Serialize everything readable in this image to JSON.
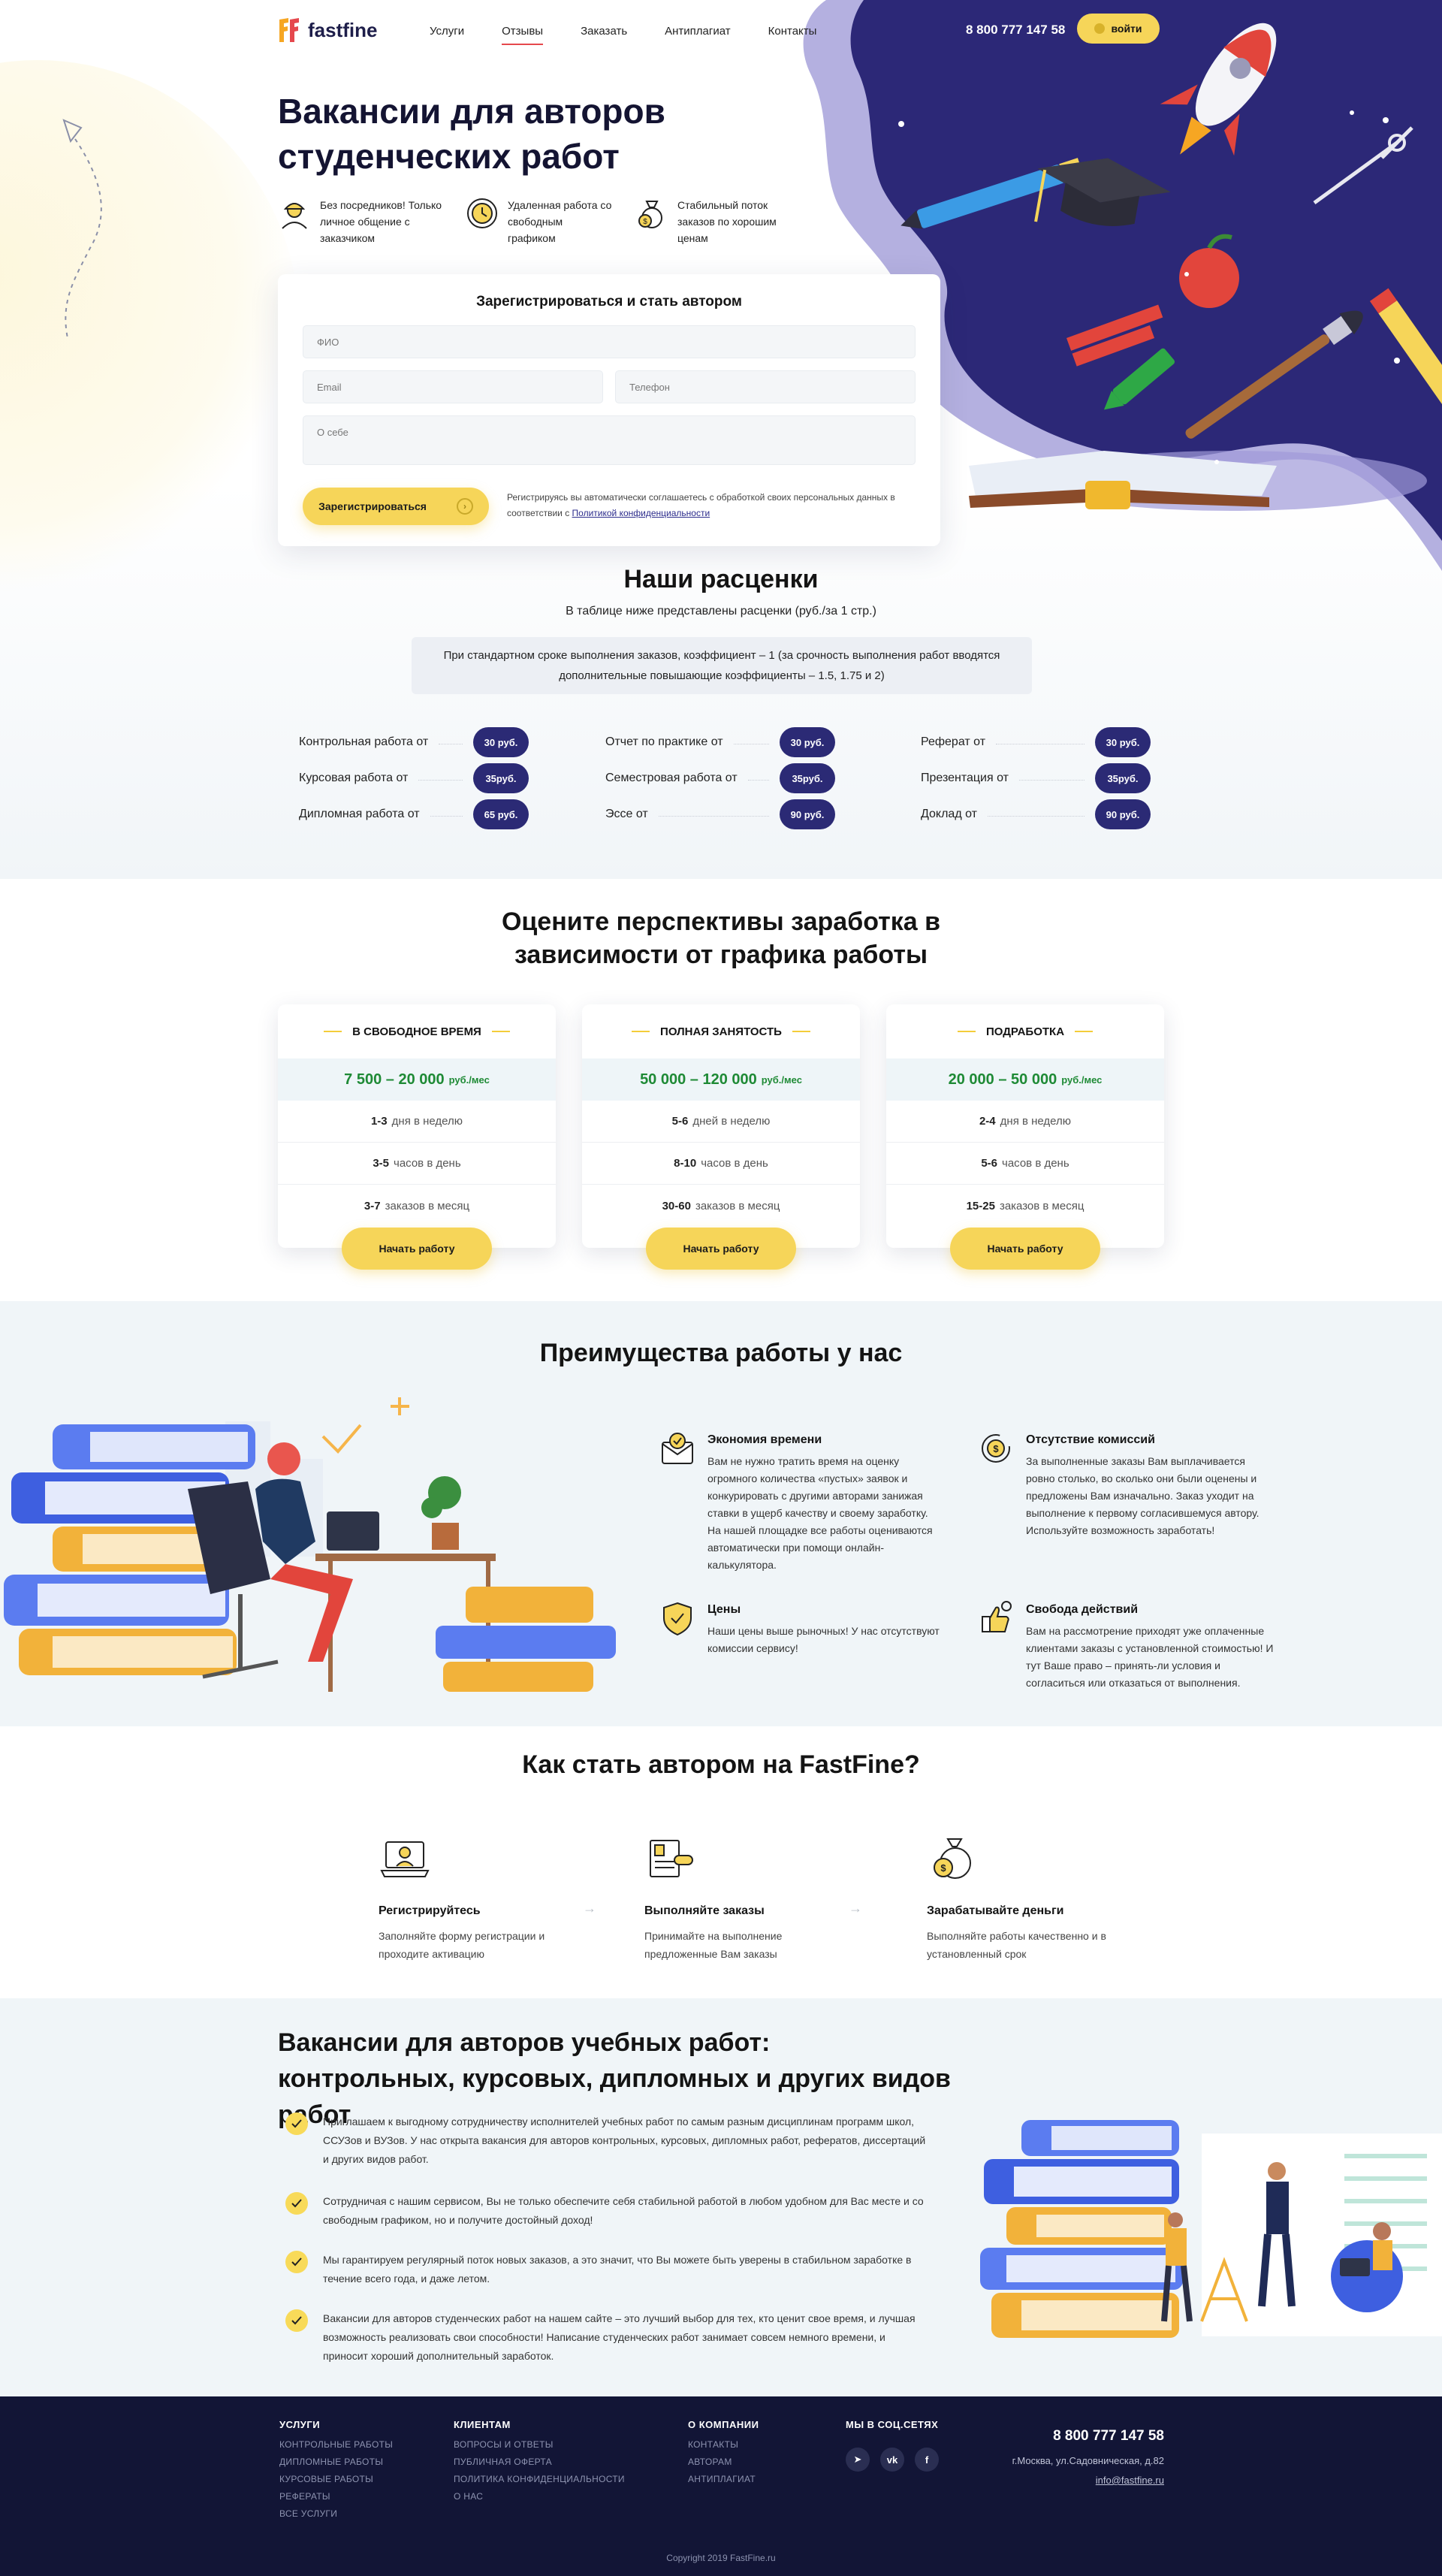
{
  "header": {
    "logo_text": "fastfine",
    "nav": [
      "Услуги",
      "Отзывы",
      "Заказать",
      "Антиплагиат",
      "Контакты"
    ],
    "phone": "8 800 777 147 58",
    "login_label": "войти"
  },
  "hero": {
    "title": "Вакансии для авторов студенческих работ",
    "features": [
      {
        "icon": "person-helmet-icon",
        "text": "Без посредников! Только личное общение с заказчиком"
      },
      {
        "icon": "clock-icon",
        "text": "Удаленная работа со свободным графиком"
      },
      {
        "icon": "money-bag-icon",
        "text": "Стабильный поток заказов по хорошим ценам"
      }
    ]
  },
  "form": {
    "title": "Зарегистрироваться и стать автором",
    "name_placeholder": "ФИО",
    "email_placeholder": "Email",
    "phone_placeholder": "Телефон",
    "about_placeholder": "О себе",
    "submit_label": "Зарегистрироваться",
    "note_text": "Регистрируясь вы автоматически соглашаетесь с обработкой своих персональных данных в соответствии с",
    "note_link": "Политикой конфиденциальности"
  },
  "prices": {
    "title": "Наши расценки",
    "subtitle": "В таблице ниже представлены расценки (руб./за 1 стр.)",
    "note_line1": "При стандартном сроке выполнения заказов, коэффициент – 1 (за срочность выполнения работ вводятся",
    "note_line2": "дополнительные повышающие коэффициенты – 1.5, 1.75 и 2)",
    "items": [
      {
        "label": "Контрольная работа от",
        "price": "30 руб."
      },
      {
        "label": "Отчет по практике от",
        "price": "30 руб."
      },
      {
        "label": "Реферат от",
        "price": "30 руб."
      },
      {
        "label": "Курсовая работа от",
        "price": "35руб."
      },
      {
        "label": "Семестровая работа от",
        "price": "35руб."
      },
      {
        "label": "Презентация от",
        "price": "35руб."
      },
      {
        "label": "Дипломная работа от",
        "price": "65 руб."
      },
      {
        "label": "Эссе от",
        "price": "90 руб."
      },
      {
        "label": "Доклад от",
        "price": "90 руб."
      }
    ]
  },
  "plans": {
    "title_line1": "Оцените перспективы заработка в",
    "title_line2": "зависимости от графика работы",
    "cta_label": "Начать работу",
    "items": [
      {
        "name": "В СВОБОДНОЕ ВРЕМЯ",
        "income": "7 500 – 20 000",
        "unit": "руб./мес",
        "days_num": "1-3",
        "days_text": "дня в неделю",
        "hours_num": "3-5",
        "hours_text": "часов в день",
        "orders_num": "3-7",
        "orders_text": "заказов в месяц"
      },
      {
        "name": "ПОЛНАЯ ЗАНЯТОСТЬ",
        "income": "50 000 – 120 000",
        "unit": "руб./мес",
        "days_num": "5-6",
        "days_text": "дней в неделю",
        "hours_num": "8-10",
        "hours_text": "часов в день",
        "orders_num": "30-60",
        "orders_text": "заказов в месяц"
      },
      {
        "name": "ПОДРАБОТКА",
        "income": "20 000 – 50 000",
        "unit": "руб./мес",
        "days_num": "2-4",
        "days_text": "дня в неделю",
        "hours_num": "5-6",
        "hours_text": "часов в день",
        "orders_num": "15-25",
        "orders_text": "заказов в месяц"
      }
    ]
  },
  "advantages": {
    "title": "Преимущества работы у нас",
    "items": [
      {
        "icon": "envelope-check-icon",
        "title": "Экономия времени",
        "text": "Вам не нужно тратить время на оценку огромного количества «пустых» заявок и конкурировать с другими авторами занижая ставки в ущерб качеству и своему заработку. На нашей площадке все работы оцениваются автоматически при помощи онлайн-калькулятора."
      },
      {
        "icon": "dollar-cycle-icon",
        "title": "Отсутствие комиссий",
        "text": "За выполненные заказы Вам выплачивается ровно столько, во сколько они были оценены и предложены Вам изначально. Заказ уходит на выполнение к первому согласившемуся автору. Используйте возможность заработать!"
      },
      {
        "icon": "shield-check-icon",
        "title": "Цены",
        "text": "Наши цены выше рыночных! У нас отсутствуют комиссии сервису!"
      },
      {
        "icon": "hand-thumb-icon",
        "title": "Свобода действий",
        "text": "Вам на рассмотрение приходят уже оплаченные клиентами заказы с установленной стоимостью! И тут Ваше право – принять-ли условия и согласиться или отказаться от выполнения."
      }
    ]
  },
  "steps": {
    "title": "Как стать автором на FastFine?",
    "items": [
      {
        "icon": "laptop-user-icon",
        "title": "Регистрируйтесь",
        "text": "Заполняйте форму регистрации и проходите активацию"
      },
      {
        "icon": "documents-icon",
        "title": "Выполняйте заказы",
        "text": "Принимайте на выполнение предложенные Вам заказы"
      },
      {
        "icon": "coin-bag-icon",
        "title": "Зарабатывайте деньги",
        "text": "Выполняйте работы качественно и в установленный срок"
      }
    ]
  },
  "vacancies": {
    "title": "Вакансии для авторов учебных работ: контрольных, курсовых, дипломных и других видов работ",
    "items": [
      "Приглашаем к выгодному сотрудничеству исполнителей учебных работ по самым разным дисциплинам программ школ, ССУЗов и ВУЗов. У нас открыта вакансия для авторов контрольных, курсовых, дипломных работ, рефератов, диссертаций и других видов работ.",
      "Сотрудничая с нашим сервисом, Вы не только обеспечите себя стабильной работой в любом удобном для Вас месте и со свободным графиком, но и получите достойный доход!",
      "Мы гарантируем регулярный поток новых заказов, а это значит, что Вы можете быть уверены в стабильном заработке в течение всего года, и даже летом.",
      "Вакансии для авторов студенческих работ на нашем сайте – это лучший выбор для тех, кто ценит свое время, и лучшая возможность реализовать свои способности! Написание студенческих работ занимает совсем немного времени, и приносит хороший дополнительный заработок."
    ]
  },
  "footer": {
    "columns": [
      {
        "title": "УСЛУГИ",
        "links": [
          "КОНТРОЛЬНЫЕ РАБОТЫ",
          "ДИПЛОМНЫЕ РАБОТЫ",
          "КУРСОВЫЕ РАБОТЫ",
          "РЕФЕРАТЫ",
          "ВСЕ УСЛУГИ"
        ]
      },
      {
        "title": "КЛИЕНТАМ",
        "links": [
          "ВОПРОСЫ И ОТВЕТЫ",
          "ПУБЛИЧНАЯ ОФЕРТА",
          "ПОЛИТИКА КОНФИДЕНЦИАЛЬНОСТИ",
          "О НАС"
        ]
      },
      {
        "title": "О КОМПАНИИ",
        "links": [
          "КОНТАКТЫ",
          "АВТОРАМ",
          "АНТИПЛАГИАТ"
        ]
      }
    ],
    "social_title": "МЫ В СОЦ.СЕТЯХ",
    "social": [
      "telegram-icon",
      "vk-icon",
      "facebook-icon"
    ],
    "phone": "8 800 777 147 58",
    "address": "г.Москва, ул.Садовническая, д.82",
    "email": "info@fastfine.ru",
    "copyright": "Copyright 2019 FastFine.ru"
  },
  "colors": {
    "accent_yellow": "#f6d559",
    "navy": "#2b2a75",
    "hero_purple": "#2c2877",
    "price_green": "#1e8a35",
    "footer_bg": "#121536"
  }
}
